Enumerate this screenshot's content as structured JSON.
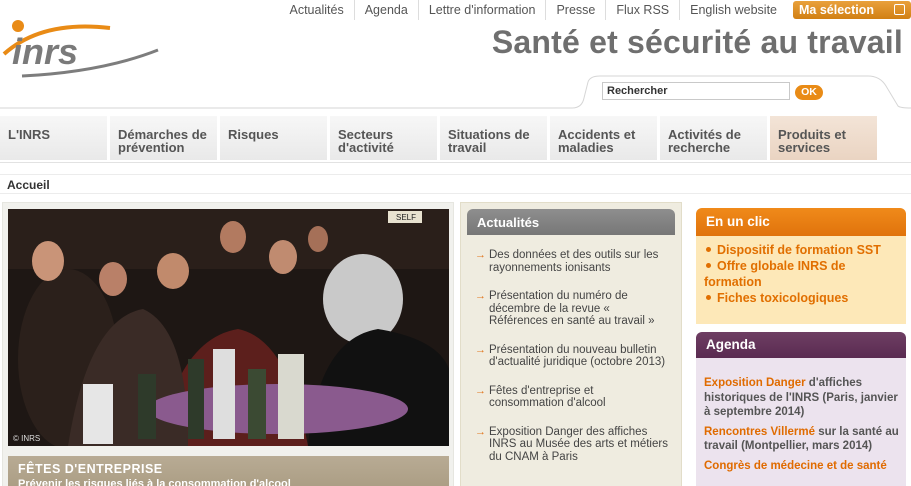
{
  "toplinks": [
    "Actualités",
    "Agenda",
    "Lettre d'information",
    "Presse",
    "Flux RSS",
    "English website"
  ],
  "ma_selection": "Ma sélection",
  "logo_text": "inrs",
  "site_title": "Santé et sécurité au travail",
  "search": {
    "value": "Rechercher",
    "button": "OK"
  },
  "nav": [
    "L'INRS",
    "Démarches de prévention",
    "Risques",
    "Secteurs d'activité",
    "Situations de travail",
    "Accidents et maladies",
    "Activités de recherche",
    "Produits et services"
  ],
  "breadcrumb": "Accueil",
  "feature": {
    "credit": "© INRS",
    "sign": "SELF",
    "title": "FÊTES D'ENTREPRISE",
    "subtitle": "Prévenir les risques liés à la consommation d'alcool"
  },
  "actualites": {
    "title": "Actualités",
    "items": [
      "Des données et des outils sur les rayonnements ionisants",
      "Présentation du numéro de décembre de la revue « Références en santé au travail »",
      "Présentation du nouveau bulletin d'actualité juridique (octobre 2013)",
      "Fêtes d'entreprise et consommation d'alcool",
      "Exposition Danger des affiches INRS au Musée des arts et métiers du CNAM à Paris"
    ]
  },
  "en_un_clic": {
    "title": "En un clic",
    "items": [
      "Dispositif de formation SST",
      "Offre globale INRS de formation",
      "Fiches toxicologiques"
    ]
  },
  "agenda": {
    "title": "Agenda",
    "items": [
      {
        "highlight": "Exposition Danger",
        "rest": " d'affiches historiques de l'INRS (Paris, janvier à septembre 2014)"
      },
      {
        "highlight": "Rencontres Villermé",
        "rest": " sur la santé au travail (Montpellier, mars 2014)"
      },
      {
        "highlight": "Congrès de médecine et de santé",
        "rest": ""
      }
    ]
  },
  "colors": {
    "orange": "#e98b16",
    "purple": "#5a2b51",
    "grey_title": "#6f6f6f"
  }
}
